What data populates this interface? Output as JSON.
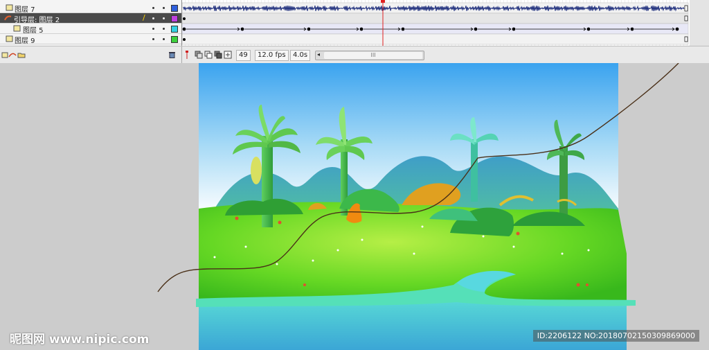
{
  "layers": [
    {
      "name": "图层 7",
      "color": "#2f5fdc",
      "type": "normal"
    },
    {
      "name": "引导层: 图层 2",
      "color": "#c040e0",
      "type": "guide",
      "selected": true
    },
    {
      "name": "图层 5",
      "color": "#33cfe0",
      "type": "guided"
    },
    {
      "name": "图层 9",
      "color": "#3ccf3c",
      "type": "normal"
    }
  ],
  "timeline": {
    "current_frame": "49",
    "frame_rate": "12.0 fps",
    "elapsed_time": "4.0s",
    "scrollbar_grip": "III"
  },
  "toolbar_icons": [
    "insert-layer-icon",
    "motion-guide-icon",
    "insert-folder-icon",
    "delete-layer-icon"
  ],
  "frame_tool_icons": [
    "center-frame-icon",
    "onion-skin-icon",
    "onion-outline-icon",
    "edit-multiple-frames-icon",
    "modify-markers-icon"
  ],
  "watermark": {
    "left": "昵图网 www.nipic.com",
    "right": "ID:2206122 NO:20180702150309869000"
  }
}
